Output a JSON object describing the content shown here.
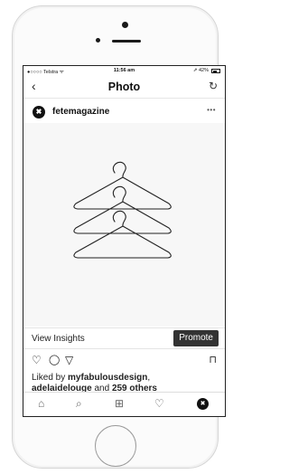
{
  "status_bar": {
    "carrier": "●○○○○ Telstra ᯤ",
    "time": "11:56 am",
    "battery": "⇗ 42%"
  },
  "nav": {
    "back_icon": "‹",
    "title": "Photo",
    "refresh_icon": "↻"
  },
  "post": {
    "avatar_glyph": "✖",
    "username": "fetemagazine",
    "more_icon": "•••",
    "insights_label": "View Insights",
    "promote_label": "Promote",
    "liked_prefix": "Liked by ",
    "liked_user": "myfabulousdesign",
    "liked_line2_user": "adelaidelouge",
    "liked_line2_mid": " and ",
    "liked_count": "259 others"
  },
  "actions": {
    "like_icon": "♡",
    "comment_icon": "◯",
    "share_icon": "▽",
    "bookmark_icon": "⊓"
  },
  "tab_bar": {
    "home_icon": "⌂",
    "search_icon": "⌕",
    "add_icon": "⊞",
    "activity_icon": "♡",
    "profile_glyph": "✖"
  }
}
